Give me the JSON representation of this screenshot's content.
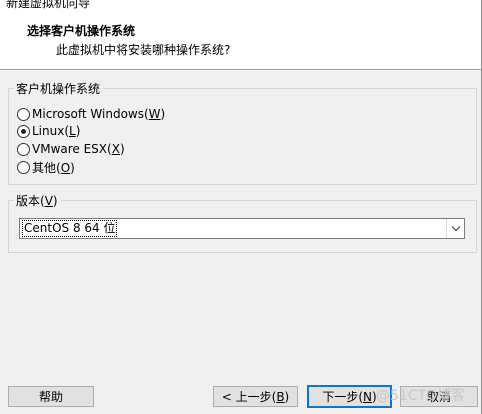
{
  "window": {
    "title": "新建虚拟机向导"
  },
  "header": {
    "heading": "选择客户机操作系统",
    "subheading": "此虚拟机中将安装哪种操作系统?"
  },
  "os_group": {
    "legend": "客户机操作系统",
    "options": [
      {
        "label": "Microsoft Windows(",
        "hotkey": "W",
        "close": ")",
        "checked": false
      },
      {
        "label": "Linux(",
        "hotkey": "L",
        "close": ")",
        "checked": true
      },
      {
        "label": "VMware ESX(",
        "hotkey": "X",
        "close": ")",
        "checked": false
      },
      {
        "label": "其他(",
        "hotkey": "O",
        "close": ")",
        "checked": false
      }
    ]
  },
  "version_group": {
    "legend_prefix": "版本(",
    "legend_hotkey": "V",
    "legend_suffix": ")",
    "selected": "CentOS 8 64 位"
  },
  "buttons": {
    "help": "帮助",
    "back_prefix": "< 上一步(",
    "back_hotkey": "B",
    "back_suffix": ")",
    "next_prefix": "下一步(",
    "next_hotkey": "N",
    "next_suffix": ")",
    "cancel": "取消"
  },
  "watermark": "@51CTO博客",
  "colors": {
    "focus_border": "#0078d7",
    "dialog_bg": "#f0f0f0",
    "header_bg": "#ffffff"
  }
}
